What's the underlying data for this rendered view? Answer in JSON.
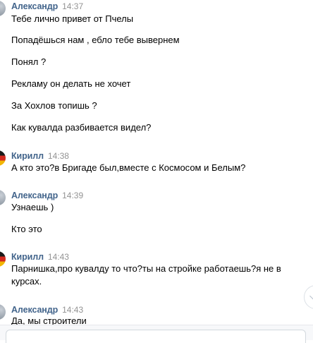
{
  "messages": [
    {
      "author": "Александр",
      "time": "14:37",
      "lines": [
        "Тебе лично привет от Пчелы",
        "Попадёшься нам , ебло тебе вывернем",
        "Понял ?",
        "Рекламу он делать не хочет",
        "За Хохлов топишь ?",
        "Как кувалда разбивается видел?"
      ]
    },
    {
      "author": "Кирилл",
      "time": "14:38",
      "lines": [
        "А кто это?в Бригаде был,вместе с Космосом и Белым?"
      ]
    },
    {
      "author": "Александр",
      "time": "14:39",
      "lines": [
        "Узнаешь )",
        "Кто это"
      ]
    },
    {
      "author": "Кирилл",
      "time": "14:43",
      "lines": [
        "Парнишка,про кувалду то что?ты на стройке работаешь?я не в курсах."
      ]
    },
    {
      "author": "Александр",
      "time": "14:43",
      "lines": [
        "Да, мы строители"
      ]
    }
  ],
  "colors": {
    "author": "#42648b",
    "time": "#939393",
    "text": "#000000"
  },
  "icons": {
    "scroll_down": "chevron-down-icon"
  }
}
